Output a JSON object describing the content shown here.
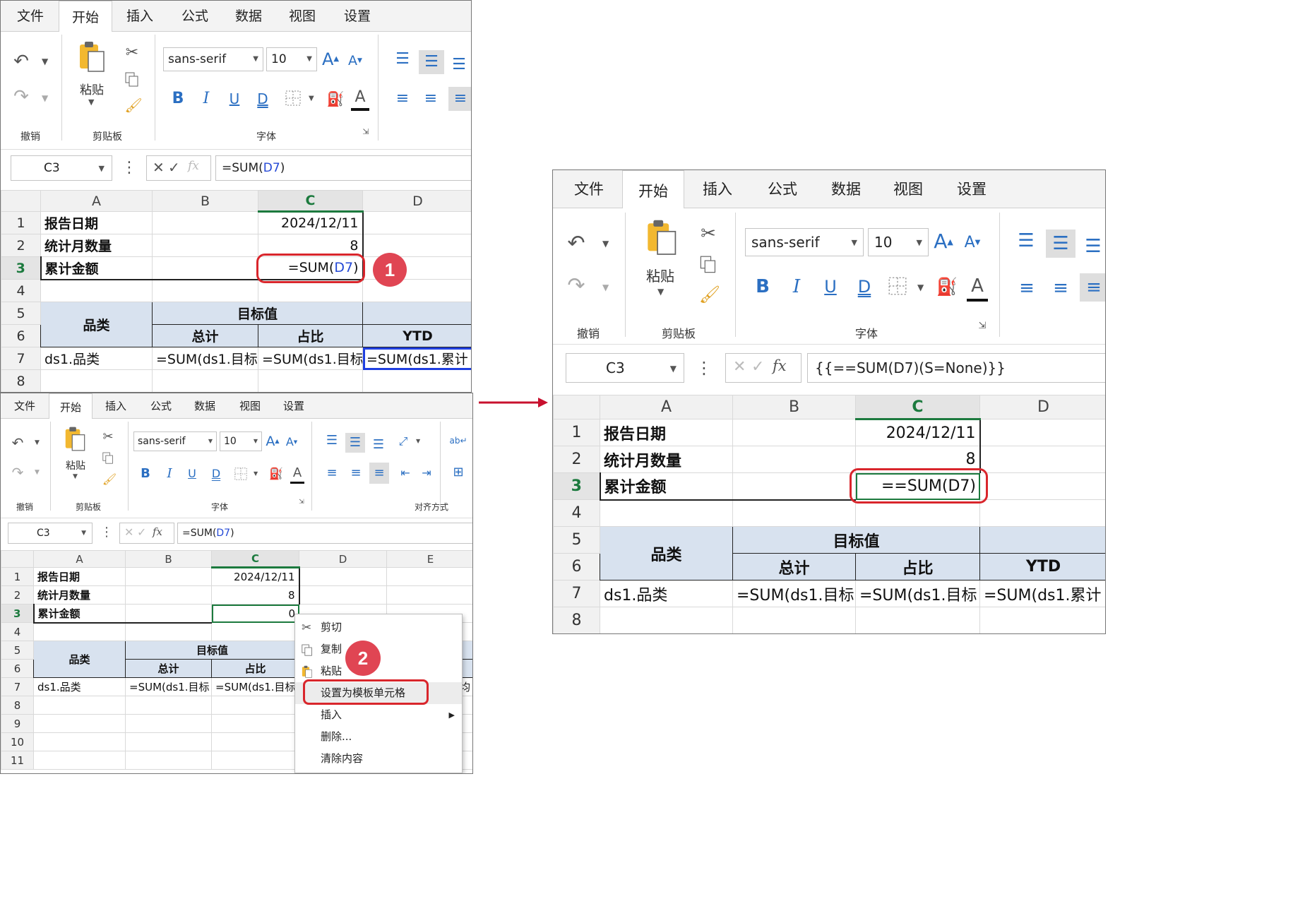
{
  "tabs": [
    "文件",
    "开始",
    "插入",
    "公式",
    "数据",
    "视图",
    "设置"
  ],
  "ribbon": {
    "undo_group": "撤销",
    "clipboard_group": "剪贴板",
    "paste_label": "粘贴",
    "font_group": "字体",
    "align_group": "对齐方式",
    "font_name": "sans-serif",
    "font_size": "10",
    "bold": "B",
    "italic": "I",
    "underline": "U",
    "double_underline": "D",
    "font_color_letter": "A"
  },
  "panel1": {
    "cell_ref": "C3",
    "formula_prefix": "=SUM(",
    "formula_ref": "D7",
    "formula_suffix": ")",
    "cols": [
      "A",
      "B",
      "C",
      "D"
    ],
    "rows": [
      "1",
      "2",
      "3",
      "4",
      "5",
      "6",
      "7",
      "8"
    ],
    "a1": "报告日期",
    "c1": "2024/12/11",
    "a2": "统计月数量",
    "c2": "8",
    "a3": "累计金额",
    "c3_prefix": "=SUM(",
    "c3_ref": "D7",
    "c3_suffix": ")",
    "a5": "品类",
    "b5": "目标值",
    "b6": "总计",
    "c6": "占比",
    "d6": "YTD",
    "a7": "ds1.品类",
    "b7": "=SUM(ds1.目标",
    "c7": "=SUM(ds1.目标",
    "d7": "=SUM(ds1.累计",
    "badge": "1"
  },
  "panel2": {
    "cell_ref": "C3",
    "formula_prefix": "=SUM(",
    "formula_ref": "D7",
    "formula_suffix": ")",
    "cols": [
      "A",
      "B",
      "C",
      "D",
      "E"
    ],
    "rows": [
      "1",
      "2",
      "3",
      "4",
      "5",
      "6",
      "7",
      "8",
      "9",
      "10",
      "11"
    ],
    "a1": "报告日期",
    "c1": "2024/12/11",
    "a2": "统计月数量",
    "c2": "8",
    "a3": "累计金额",
    "c3": "0",
    "a5": "品类",
    "b5": "目标值",
    "b6": "总计",
    "c6": "占比",
    "a7": "ds1.品类",
    "b7": "=SUM(ds1.目标",
    "c7": "=SUM(ds1.目标",
    "e7": "均",
    "menu": [
      "剪切",
      "复制",
      "粘贴",
      "设置为模板单元格",
      "插入",
      "删除...",
      "清除内容"
    ],
    "badge": "2"
  },
  "panel3": {
    "cell_ref": "C3",
    "formula": "{{==SUM(D7)(S=None)}}",
    "cols": [
      "A",
      "B",
      "C",
      "D"
    ],
    "rows": [
      "1",
      "2",
      "3",
      "4",
      "5",
      "6",
      "7",
      "8"
    ],
    "a1": "报告日期",
    "c1": "2024/12/11",
    "a2": "统计月数量",
    "c2": "8",
    "a3": "累计金额",
    "c3": "==SUM(D7)",
    "a5": "品类",
    "b5": "目标值",
    "b6": "总计",
    "c6": "占比",
    "d6": "YTD",
    "a7": "ds1.品类",
    "b7": "=SUM(ds1.目标",
    "c7": "=SUM(ds1.目标",
    "d7": "=SUM(ds1.累计"
  },
  "colors": {
    "accent_red": "#d9262c",
    "badge": "#e04553",
    "header_fill": "#d8e2ef",
    "select_green": "#1c7a3e",
    "select_blue": "#1f3fe0"
  }
}
